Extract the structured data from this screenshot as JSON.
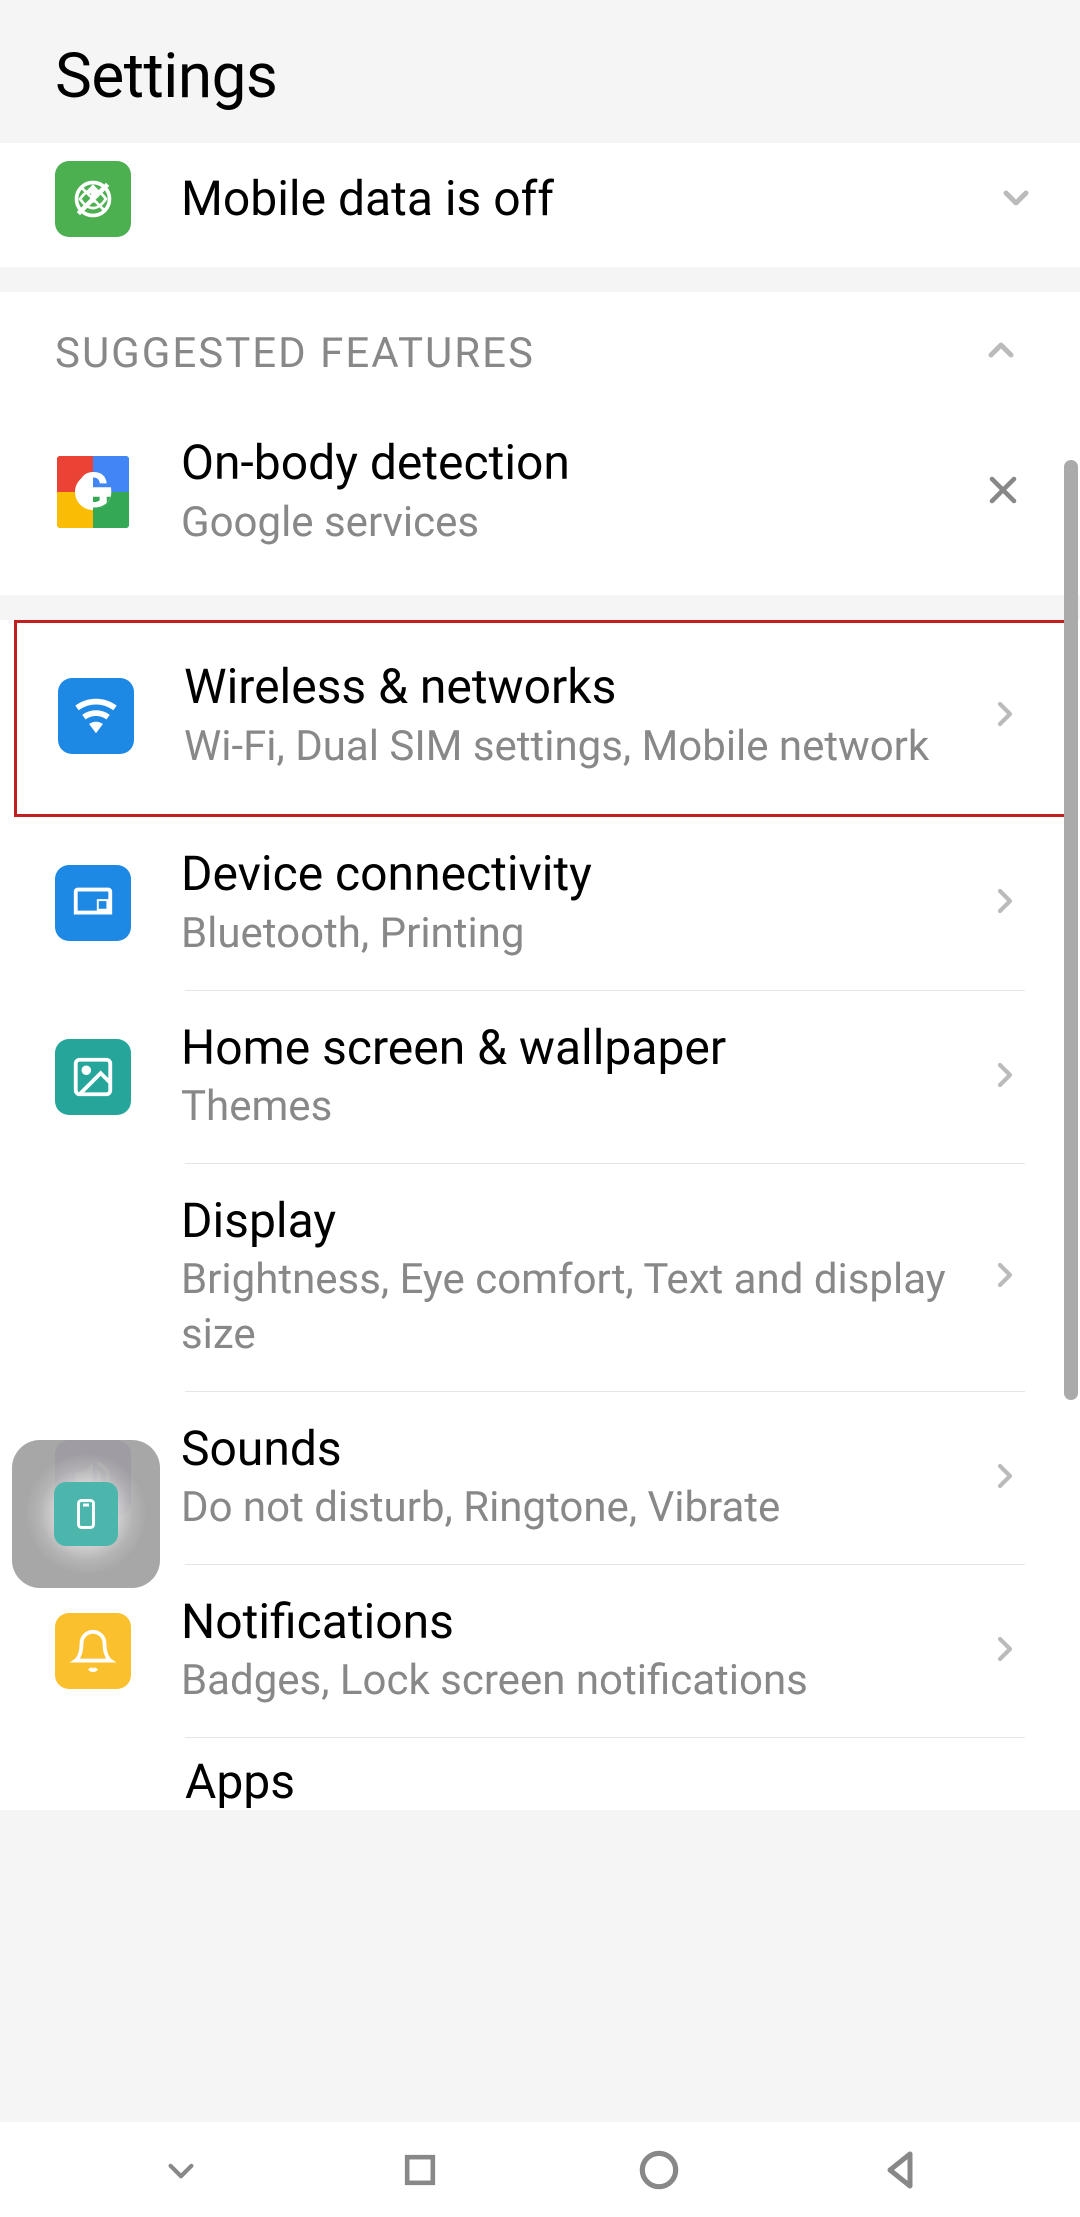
{
  "header": {
    "title": "Settings"
  },
  "mobile_data": {
    "title": "Mobile data is off"
  },
  "suggested": {
    "section_title": "SUGGESTED FEATURES",
    "item": {
      "title": "On-body detection",
      "subtitle": "Google services"
    }
  },
  "settings": [
    {
      "title": "Wireless & networks",
      "subtitle": "Wi-Fi, Dual SIM settings, Mobile network",
      "icon": "wifi",
      "color": "blue",
      "highlighted": true
    },
    {
      "title": "Device connectivity",
      "subtitle": "Bluetooth, Printing",
      "icon": "devices",
      "color": "blue"
    },
    {
      "title": "Home screen & wallpaper",
      "subtitle": "Themes",
      "icon": "image",
      "color": "green"
    },
    {
      "title": "Display",
      "subtitle": "Brightness, Eye comfort, Text and display size",
      "icon": "phone",
      "color": "teal"
    },
    {
      "title": "Sounds",
      "subtitle": "Do not disturb, Ringtone, Vibrate",
      "icon": "volume",
      "color": "purple"
    },
    {
      "title": "Notifications",
      "subtitle": "Badges, Lock screen notifications",
      "icon": "bell",
      "color": "yellow"
    }
  ],
  "partial_item": "Apps"
}
